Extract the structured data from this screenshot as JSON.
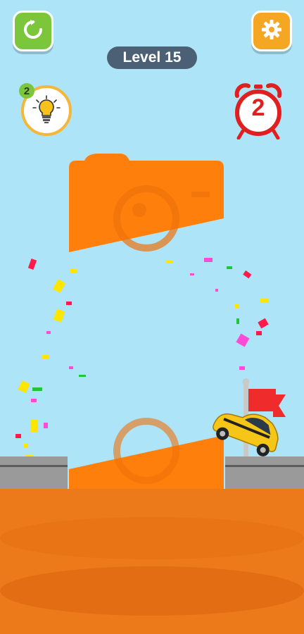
{
  "header": {
    "level_label": "Level 15"
  },
  "hints": {
    "count": "2"
  },
  "timer": {
    "count": "2"
  },
  "icons": {
    "restart": "restart-icon",
    "settings": "gear-icon",
    "hint": "lightbulb-icon",
    "timer": "alarm-clock-icon",
    "flag": "flag-icon"
  },
  "colors": {
    "sky": "#aee4f7",
    "puzzle_shape": "#ff7f0c",
    "ground": "#ed7a1a",
    "road": "#9a9a9a",
    "restart_button": "#7bc63b",
    "settings_button": "#f5a623",
    "level_pill": "#4b6075",
    "timer": "#e02020",
    "car": "#f5c518",
    "flag": "#ef2b2b"
  }
}
